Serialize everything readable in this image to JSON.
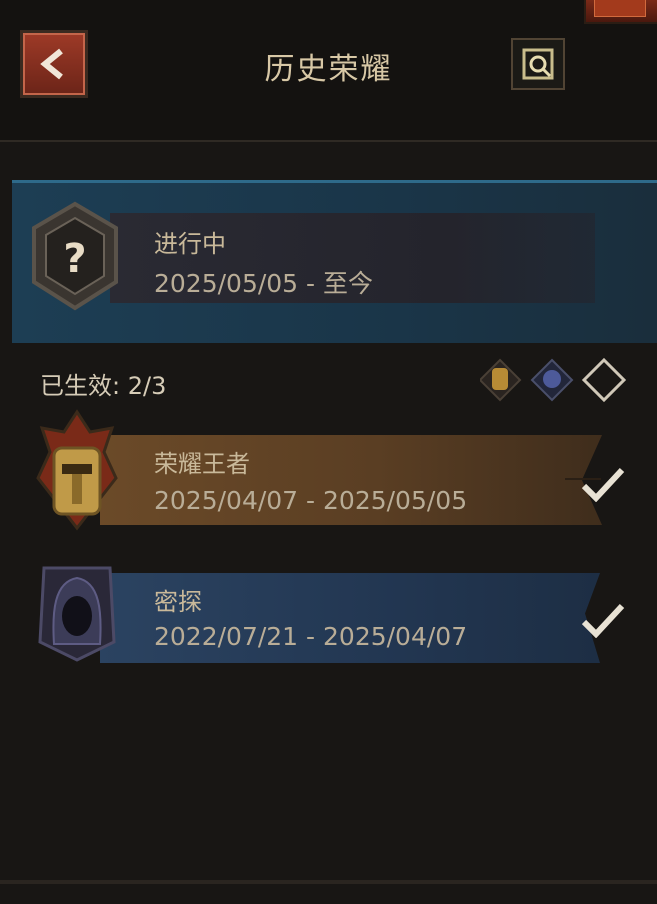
{
  "header": {
    "title": "历史荣耀"
  },
  "icons": {
    "back": "back-arrow-icon",
    "help": "help-scroll-icon",
    "current_badge": "question-mark-badge-icon",
    "gold_badge": "golden-helmet-badge-icon",
    "blue_badge": "hooded-figure-badge-icon",
    "check": "checkmark-icon"
  },
  "current": {
    "name": "进行中",
    "date": "2025/05/05 - 至今"
  },
  "summary": {
    "effective_label": "已生效: 2/3"
  },
  "history": [
    {
      "name": "荣耀王者",
      "date": "2025/04/07 - 2025/05/05"
    },
    {
      "name": "密探",
      "date": "2022/07/21 - 2025/04/07"
    }
  ],
  "colors": {
    "gold_band": "#6b4a28",
    "blue_band": "#2b4361",
    "current_card": "#1d3e54",
    "accent_red": "#9e3a27"
  }
}
